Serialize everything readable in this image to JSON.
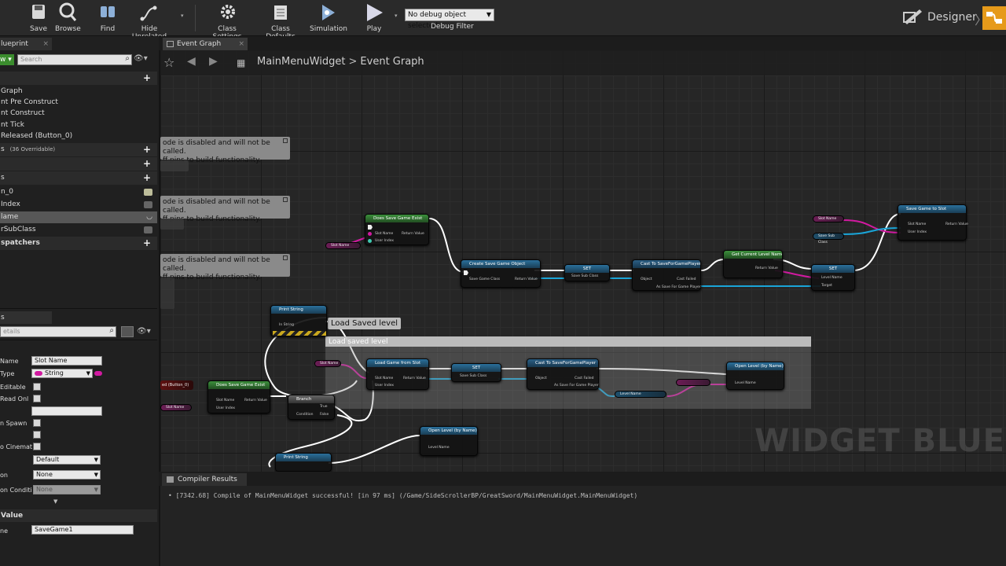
{
  "toolbar": {
    "buttons": [
      {
        "label": "Save",
        "icon": "save-icon"
      },
      {
        "label": "Browse",
        "icon": "browse-icon"
      },
      {
        "label": "Find",
        "icon": "find-icon"
      },
      {
        "label": "Hide Unrelated",
        "icon": "hide-unrelated-icon"
      },
      {
        "label": "Class Settings",
        "icon": "class-settings-icon"
      },
      {
        "label": "Class Defaults",
        "icon": "class-defaults-icon"
      },
      {
        "label": "Simulation",
        "icon": "simulation-icon"
      },
      {
        "label": "Play",
        "icon": "play-icon"
      }
    ],
    "debug_selected": "No debug object selected",
    "debug_label": "Debug Filter",
    "designer_label": "Designer"
  },
  "my_blueprint": {
    "tab": "lueprint",
    "search_placeholder": "Search",
    "add_label": "w",
    "graphs": [
      "Graph",
      "nt Pre Construct",
      "nt Construct",
      "nt Tick",
      "Released (Button_0)"
    ],
    "functions_header": "s",
    "functions_overridable": "(36 Overridable)",
    "macros_header": "",
    "variables_header": "s",
    "variables": [
      {
        "name": "n_0",
        "selected": false,
        "icon_on": true
      },
      {
        "name": "Index",
        "selected": false,
        "icon_on": false
      },
      {
        "name": "lame",
        "selected": true,
        "icon_on": false
      },
      {
        "name": "rSubClass",
        "selected": false,
        "icon_on": false
      }
    ],
    "dispatchers_header": "spatchers"
  },
  "details": {
    "tab": "s",
    "search_placeholder": "etails",
    "props": [
      {
        "label": "Name",
        "value": "Slot Name",
        "kind": "text"
      },
      {
        "label": "Type",
        "value": "String",
        "kind": "combo"
      },
      {
        "label": "Editable",
        "kind": "check"
      },
      {
        "label": " Read Onl",
        "kind": "check"
      },
      {
        "label": "",
        "value": "",
        "kind": "text"
      },
      {
        "label": "n Spawn",
        "kind": "check"
      },
      {
        "label": "",
        "kind": "check"
      },
      {
        "label": "o Cinemat",
        "kind": "check"
      },
      {
        "label": "",
        "value": "Default",
        "kind": "combo"
      },
      {
        "label": "on",
        "value": "None",
        "kind": "combo"
      },
      {
        "label": "on Conditi",
        "value": "None",
        "kind": "combo-disabled"
      }
    ],
    "default_header": "Value",
    "default_label": "ne",
    "default_value": "SaveGame1"
  },
  "graph": {
    "tab": "Event Graph",
    "breadcrumb_root": "MainMenuWidget",
    "breadcrumb_leaf": "Event Graph",
    "disabled_comments": [
      {
        "line1": "ode is disabled and will not be called.",
        "line2": "ff pins to build functionality."
      },
      {
        "line1": "ode is disabled and will not be called.",
        "line2": "ff pins to build functionality."
      },
      {
        "line1": "ode is disabled and will not be called.",
        "line2": "ff pins to build functionality."
      }
    ],
    "bubble": "Load Saved  level",
    "group_title": "Load saved level",
    "watermark": "WIDGET BLUEPRI",
    "nodes": {
      "does_save_exist_top": "Does Save Game Exist",
      "create_save": "Create Save Game Object",
      "set1": "SET",
      "cast1": "Cast To SaveForGamePlayer",
      "get_level": "Get Current Level Name",
      "set2": "SET",
      "save_slot": "Save Game to Slot",
      "print1": "Print String",
      "load_slot": "Load Game from Slot",
      "set3": "SET",
      "cast2": "Cast To SaveForGamePlayer",
      "open_level1": "Open Level (by Name)",
      "does_save_exist_bottom": "Does Save Game Exist",
      "branch": "Branch",
      "open_level2": "Open Level (by Name)",
      "print2": "Print String",
      "event_button": "ed (Button_0)"
    },
    "pins": {
      "slot_name": "Slot Name",
      "user_index": "User Index",
      "return_value": "Return Value",
      "save_game_class": "Save Game Class",
      "object": "Object",
      "cast_failed": "Cast Failed",
      "as_save": "As Save For Game Player",
      "level_name": "Level Name",
      "target": "Target",
      "true": "True",
      "false": "False",
      "condition": "Condition",
      "in_string": "In String",
      "save_sub_class": "Save Sub Class"
    }
  },
  "compiler": {
    "tab": "Compiler Results",
    "message": "[7342.68] Compile of MainMenuWidget successful! [in 97 ms] (/Game/SideScrollerBP/GreatSword/MainMenuWidget.MainMenuWidget)"
  },
  "colors": {
    "accent": "#e69a1a",
    "string_pin": "#d11aa0",
    "object_pin": "#1aa5d8",
    "exec": "#ffffff"
  }
}
